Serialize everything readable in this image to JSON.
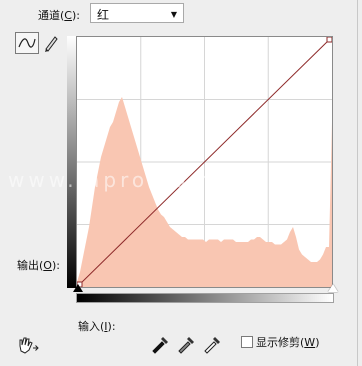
{
  "channel": {
    "label": "通道",
    "hotkey": "C",
    "selected": "红"
  },
  "axis": {
    "output_label": "输出",
    "output_hotkey": "O",
    "input_label": "输入",
    "input_hotkey": "I"
  },
  "show_clipping": {
    "label": "显示修剪",
    "hotkey": "W",
    "checked": false
  },
  "watermark": "www.lapro.com.cn",
  "icons": {
    "curve_tool": "curve-edit-icon",
    "pencil_tool": "pencil-icon",
    "hand_tool": "target-adjust-hand-icon",
    "black_point": "black-eyedropper-icon",
    "gray_point": "gray-eyedropper-icon",
    "white_point": "white-eyedropper-icon"
  },
  "colors": {
    "histogram_fill": "#f9c6b2",
    "curve_line": "#8e2a2a",
    "grid": "#d6d6d6"
  },
  "histogram": {
    "range": [
      0,
      255
    ],
    "levels": [
      0.02,
      0.06,
      0.12,
      0.18,
      0.24,
      0.32,
      0.4,
      0.46,
      0.52,
      0.56,
      0.6,
      0.64,
      0.66,
      0.7,
      0.74,
      0.76,
      0.72,
      0.68,
      0.64,
      0.6,
      0.56,
      0.52,
      0.48,
      0.44,
      0.4,
      0.37,
      0.34,
      0.31,
      0.29,
      0.28,
      0.26,
      0.24,
      0.23,
      0.22,
      0.21,
      0.2,
      0.2,
      0.19,
      0.19,
      0.19,
      0.19,
      0.19,
      0.19,
      0.18,
      0.19,
      0.19,
      0.19,
      0.19,
      0.18,
      0.19,
      0.19,
      0.19,
      0.19,
      0.18,
      0.18,
      0.18,
      0.18,
      0.18,
      0.19,
      0.19,
      0.2,
      0.2,
      0.19,
      0.18,
      0.18,
      0.18,
      0.17,
      0.17,
      0.17,
      0.18,
      0.19,
      0.22,
      0.24,
      0.2,
      0.15,
      0.13,
      0.12,
      0.11,
      0.1,
      0.1,
      0.1,
      0.11,
      0.13,
      0.16,
      0.16,
      0.66
    ],
    "curve": [
      [
        0,
        0
      ],
      [
        255,
        255
      ]
    ]
  }
}
